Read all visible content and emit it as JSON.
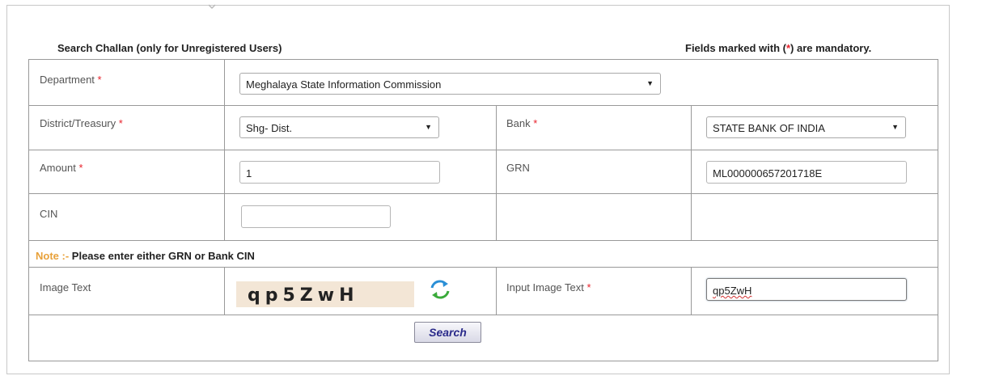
{
  "header": {
    "title": "Search Challan (only for Unregistered Users)",
    "mandatory_prefix": "Fields marked with (",
    "mandatory_star": "*",
    "mandatory_suffix": ") are mandatory."
  },
  "form": {
    "department": {
      "label": "Department",
      "required": "*",
      "value": "Meghalaya State Information Commission"
    },
    "district": {
      "label": "District/Treasury",
      "required": "*",
      "value": "Shg- Dist."
    },
    "bank": {
      "label": "Bank",
      "required": "*",
      "value": "STATE BANK OF INDIA"
    },
    "amount": {
      "label": "Amount",
      "required": "*",
      "value": "1"
    },
    "grn": {
      "label": "GRN",
      "value": "ML000000657201718E"
    },
    "cin": {
      "label": "CIN",
      "value": ""
    },
    "note": {
      "label": "Note :-",
      "text": " Please enter either GRN or Bank CIN"
    },
    "image_text": {
      "label": "Image Text",
      "captcha": "qp5ZwH"
    },
    "input_image_text": {
      "label": "Input Image Text",
      "required": "*",
      "value": "qp5ZwH"
    },
    "search_button": "Search"
  },
  "colors": {
    "required": "#e8222c",
    "note": "#e8a13a",
    "button_text": "#2a2a8a"
  },
  "icons": {
    "refresh": "refresh-arrows-icon",
    "dropdown": "chevron-down-icon"
  }
}
